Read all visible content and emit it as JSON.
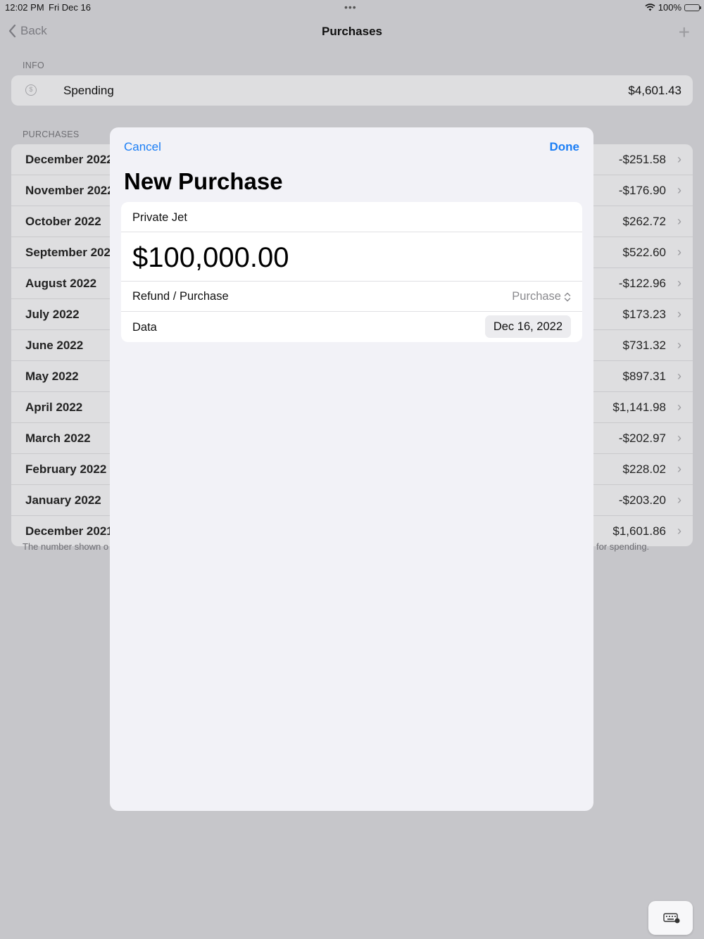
{
  "status": {
    "time": "12:02 PM",
    "date": "Fri Dec 16",
    "battery": "100%"
  },
  "nav": {
    "back": "Back",
    "title": "Purchases"
  },
  "info": {
    "section": "INFO",
    "label": "Spending",
    "value": "$4,601.43"
  },
  "purchases": {
    "section": "PURCHASES",
    "rows": [
      {
        "month": "December 2022",
        "amount": "-$251.58"
      },
      {
        "month": "November 2022",
        "amount": "-$176.90"
      },
      {
        "month": "October 2022",
        "amount": "$262.72"
      },
      {
        "month": "September 2022",
        "amount": "$522.60"
      },
      {
        "month": "August 2022",
        "amount": "-$122.96"
      },
      {
        "month": "July 2022",
        "amount": "$173.23"
      },
      {
        "month": "June 2022",
        "amount": "$731.32"
      },
      {
        "month": "May 2022",
        "amount": "$897.31"
      },
      {
        "month": "April 2022",
        "amount": "$1,141.98"
      },
      {
        "month": "March 2022",
        "amount": "-$202.97"
      },
      {
        "month": "February 2022",
        "amount": "$228.02"
      },
      {
        "month": "January 2022",
        "amount": "-$203.20"
      },
      {
        "month": "December 2021",
        "amount": "$1,601.86"
      }
    ],
    "footer_left": "The number shown o",
    "footer_right": "for spending."
  },
  "modal": {
    "cancel": "Cancel",
    "done": "Done",
    "title": "New Purchase",
    "name": "Private Jet",
    "amount": "$100,000.00",
    "kind_label": "Refund / Purchase",
    "kind_value": "Purchase",
    "date_label": "Data",
    "date_value": "Dec 16, 2022"
  }
}
